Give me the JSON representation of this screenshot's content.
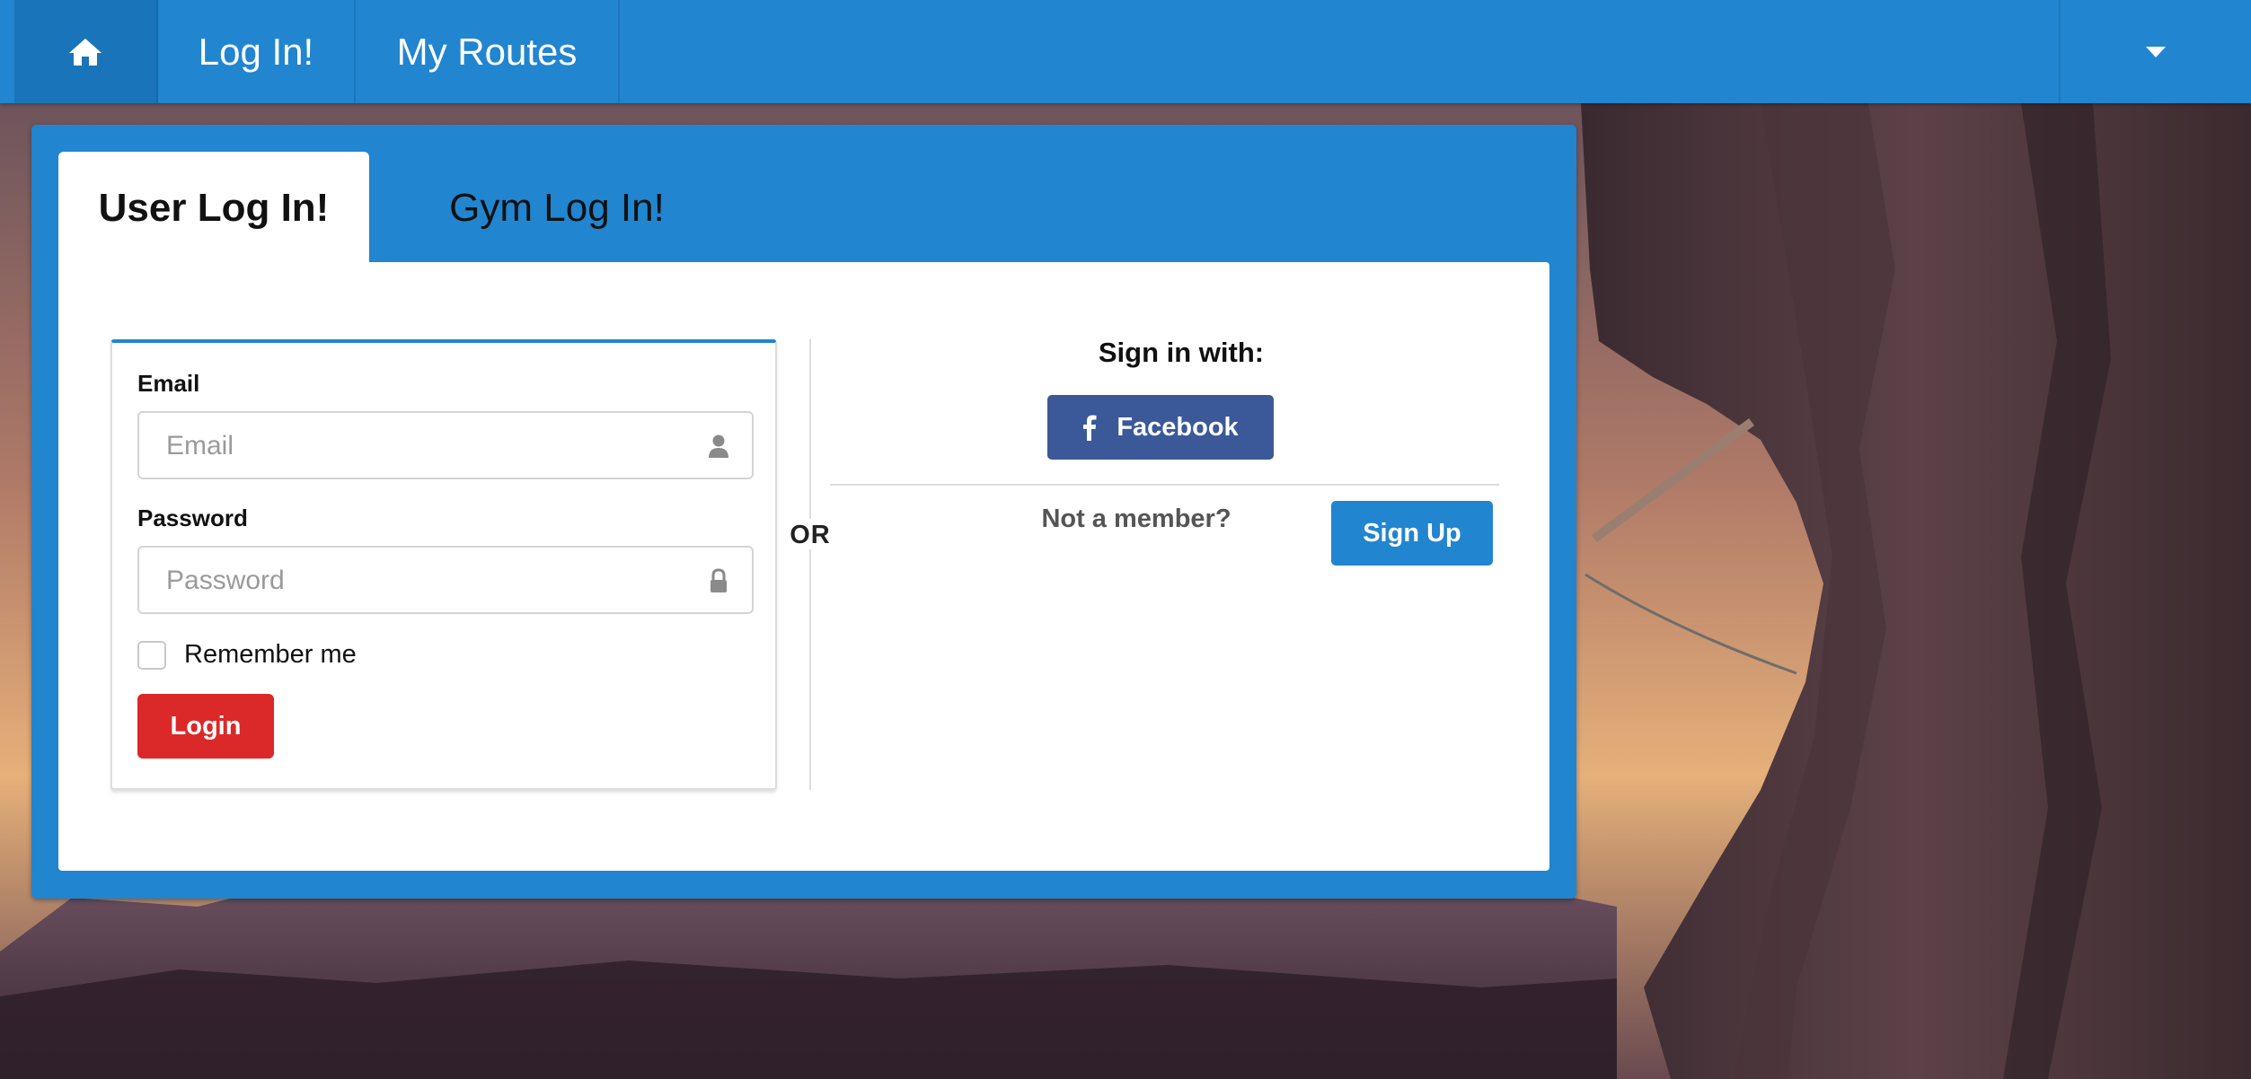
{
  "navbar": {
    "home_icon": "home-icon",
    "login_label": "Log In!",
    "routes_label": "My Routes",
    "dropdown_icon": "caret-down-icon"
  },
  "tabs": {
    "user_label": "User Log In!",
    "gym_label": "Gym Log In!"
  },
  "login_form": {
    "email_label": "Email",
    "email_placeholder": "Email",
    "email_value": "",
    "email_icon": "user-icon",
    "password_label": "Password",
    "password_placeholder": "Password",
    "password_value": "",
    "password_icon": "lock-icon",
    "remember_label": "Remember me",
    "remember_checked": false,
    "login_button": "Login"
  },
  "divider_label": "OR",
  "social": {
    "signin_with": "Sign in with:",
    "facebook_icon": "facebook-icon",
    "facebook_button": "Facebook",
    "not_member": "Not a member?",
    "signup_button": "Sign Up"
  },
  "colors": {
    "primary": "#2185d0",
    "login_red": "#db2828",
    "facebook_blue": "#3b5998"
  }
}
